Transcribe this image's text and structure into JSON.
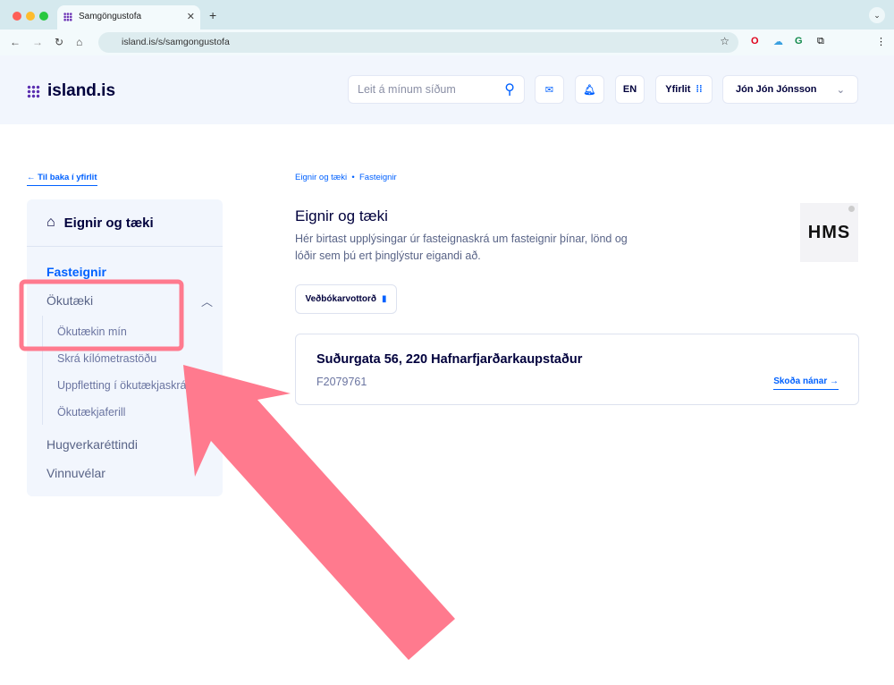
{
  "browser": {
    "tab_title": "Samgöngustofa",
    "url": "island.is/s/samgongustofa"
  },
  "header": {
    "logo": "island.is",
    "search_placeholder": "Leit á mínum síðum",
    "language": "EN",
    "overview": "Yfirlit",
    "user": "Jón Jón Jónsson"
  },
  "sidebar": {
    "back": "Til baka í yfirlit",
    "title": "Eignir og tæki",
    "items": [
      {
        "label": "Fasteignir",
        "active": true
      },
      {
        "label": "Ökutæki"
      },
      {
        "label": "Hugverkaréttindi"
      },
      {
        "label": "Vinnuvélar"
      }
    ],
    "subitems": [
      "Ökutækin mín",
      "Skrá kílómetrastöðu",
      "Uppfletting í ökutækjaskrá",
      "Ökutækjaferill"
    ]
  },
  "main": {
    "breadcrumb": [
      "Eignir og tæki",
      "Fasteignir"
    ],
    "title": "Eignir og tæki",
    "description": "Hér birtast upplýsingar úr fasteignaskrá um fasteignir þínar, lönd og lóðir sem þú ert þinglýstur eigandi að.",
    "org_logo": "HMS",
    "certificate_button": "Veðbókarvottorð",
    "property": {
      "address": "Suðurgata 56, 220 Hafnarfjarðarkaupstaður",
      "id": "F2079761",
      "link": "Skoða nánar"
    }
  },
  "colors": {
    "accent": "#0061ff",
    "annotation": "#ff7a8e"
  }
}
